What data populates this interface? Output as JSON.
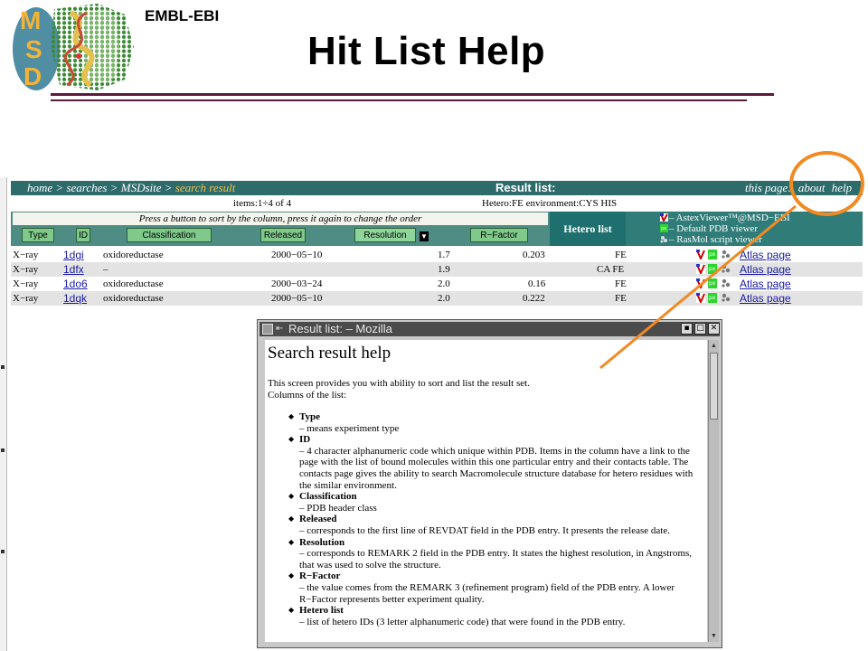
{
  "slide": {
    "org": "EMBL-EBI",
    "title": "Hit List Help"
  },
  "logo": {
    "letters": [
      "M",
      "S",
      "D"
    ]
  },
  "result": {
    "crumbs": [
      {
        "label": "home",
        "current": false
      },
      {
        "label": "searches",
        "current": false
      },
      {
        "label": "MSDsite",
        "current": false
      },
      {
        "label": "search result",
        "current": true
      }
    ],
    "separator": ">",
    "title": "Result list:",
    "page_links_label": "this page:",
    "page_links": [
      "about",
      "help"
    ],
    "items_text": "items:1÷4 of 4",
    "hetero_info": "Hetero:FE environment:CYS HIS",
    "sort_hint": "Press a button to sort by the column, press it again to change the order",
    "buttons": [
      "Type",
      "ID",
      "Classification",
      "Released",
      "Resolution",
      "R−Factor"
    ],
    "hetero_header": "Hetero list",
    "legend": [
      {
        "text": "– AstexViewer™@MSD−EBI",
        "icon": "astex-viewer-icon"
      },
      {
        "text": "– Default PDB viewer",
        "icon": "pdb-viewer-icon"
      },
      {
        "text": "– RasMol script viewer",
        "icon": "rasmol-icon"
      }
    ],
    "rows": [
      {
        "type": "X−ray",
        "id": "1dgi",
        "classification": "oxidoreductase",
        "released": "2000−05−10",
        "resolution": "1.7",
        "rfactor": "0.203",
        "hetero": "FE",
        "atlas": "Atlas page"
      },
      {
        "type": "X−ray",
        "id": "1dfx",
        "classification": "–",
        "released": "",
        "resolution": "1.9",
        "rfactor": "",
        "hetero": "CA FE",
        "atlas": "Atlas page"
      },
      {
        "type": "X−ray",
        "id": "1do6",
        "classification": "oxidoreductase",
        "released": "2000−03−24",
        "resolution": "2.0",
        "rfactor": "0.16",
        "hetero": "FE",
        "atlas": "Atlas page"
      },
      {
        "type": "X−ray",
        "id": "1dqk",
        "classification": "oxidoreductase",
        "released": "2000−05−10",
        "resolution": "2.0",
        "rfactor": "0.222",
        "hetero": "FE",
        "atlas": "Atlas page"
      }
    ]
  },
  "popup": {
    "window_title": "Result list: – Mozilla",
    "heading": "Search result help",
    "intro1": "This screen provides you with ability to sort and list the result set.",
    "intro2": "Columns of the list:",
    "items": [
      {
        "name": "Type",
        "desc": "– means experiment type"
      },
      {
        "name": "ID",
        "desc": "– 4 character alphanumeric code which unique within PDB. Items in the column have a link to the page with the list of bound molecules within this one particular entry and their contacts table. The contacts page gives the ability to search Macromolecule structure database for hetero residues with the similar environment."
      },
      {
        "name": "Classification",
        "desc": "– PDB header class"
      },
      {
        "name": "Released",
        "desc": "– corresponds to the first line of REVDAT field in the PDB entry. It presents the release date."
      },
      {
        "name": "Resolution",
        "desc": "– corresponds to REMARK 2 field in the PDB entry. It states the highest resolution, in Angstroms, that was used to solve the structure."
      },
      {
        "name": "R−Factor",
        "desc": "– the value comes from the REMARK 3 (refinement program) field of the PDB entry. A lower R−Factor represents better experiment quality."
      },
      {
        "name": "Hetero list",
        "desc": "– list of hetero IDs (3 letter alphanumeric code) that were found in the PDB entry."
      }
    ]
  },
  "colors": {
    "accent_orange": "#f08a22",
    "nav_teal": "#2e6b6b",
    "rule_maroon": "#5b1a3c",
    "link_blue": "#1a1aa6",
    "logo_green": "#3c8a35"
  }
}
